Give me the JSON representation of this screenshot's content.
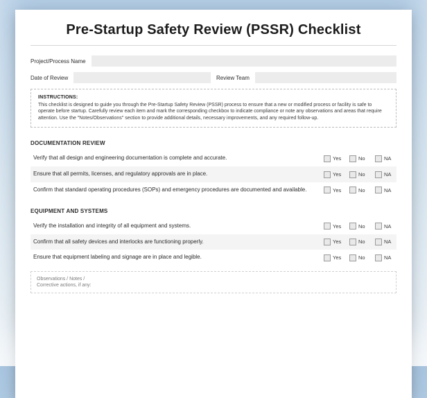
{
  "title": "Pre-Startup Safety Review (PSSR) Checklist",
  "meta": {
    "project_label": "Project/Process Name",
    "project_value": "",
    "date_label": "Date of Review",
    "date_value": "",
    "team_label": "Review Team",
    "team_value": ""
  },
  "instructions": {
    "heading": "INSTRUCTIONS:",
    "body": "This checklist is designed to guide you through the Pre-Startup Safety Review (PSSR) process to ensure that a new or modified process or facility is safe to operate before startup. Carefully review each item and mark the corresponding checkbox to indicate compliance or note any observations and areas that require attention. Use the \"Notes/Observations\" section to provide additional details, necessary improvements, and any required follow-up."
  },
  "opts": {
    "yes": "Yes",
    "no": "No",
    "na": "NA"
  },
  "sections": [
    {
      "title": "DOCUMENTATION REVIEW",
      "items": [
        "Verify that all design and engineering documentation is complete and accurate.",
        "Ensure that all permits, licenses, and regulatory approvals are in place.",
        "Confirm that standard operating procedures (SOPs) and emergency procedures are documented and available."
      ]
    },
    {
      "title": "EQUIPMENT AND SYSTEMS",
      "items": [
        "Verify the installation and integrity of all equipment and systems.",
        "Confirm that all safety devices and interlocks are functioning properly.",
        "Ensure that equipment labeling and signage are in place and legible."
      ]
    }
  ],
  "notes_label": "Observations / Notes / Corrective actions, if any:"
}
